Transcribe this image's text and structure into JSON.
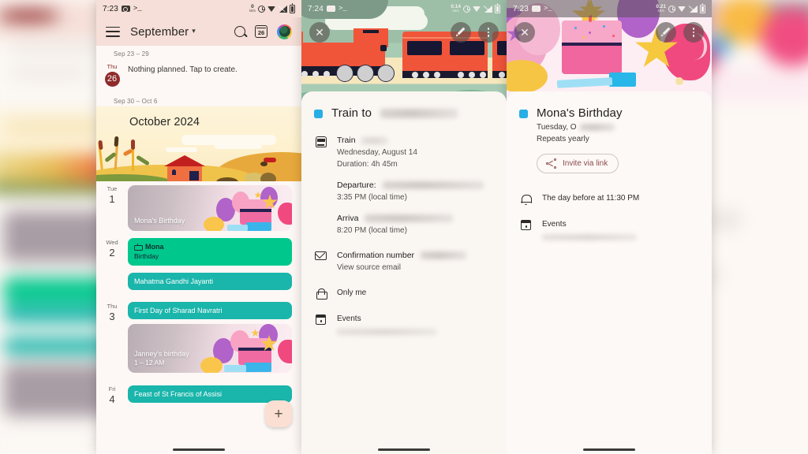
{
  "background": {
    "description": "blurred duplicate of calendar screen on left edge and birthday screen on right edge"
  },
  "panels": [
    {
      "id": "calendar",
      "statusbar": {
        "time": "7:23",
        "icons": [
          "camera-icon",
          "terminal-icon",
          "network-speed-icon",
          "alarm-icon",
          "wifi-icon",
          "signal-off-icon",
          "battery-icon"
        ],
        "network_speed_value": "0",
        "network_speed_unit": "kB/s"
      },
      "appbar": {
        "menu_icon": "hamburger-icon",
        "title": "September",
        "caret": "▾",
        "search_icon": "search-icon",
        "today_icon_label": "26",
        "avatar": "account-avatar"
      },
      "agenda": [
        {
          "type": "week-label",
          "text": "Sep 23 – 29"
        },
        {
          "type": "day",
          "weekday": "Thu",
          "day": "26",
          "today": true,
          "empty_text": "Nothing planned. Tap to create."
        },
        {
          "type": "week-label",
          "text": "Sep 30 – Oct 6"
        },
        {
          "type": "month-banner",
          "title": "October 2024"
        },
        {
          "type": "day",
          "weekday": "Tue",
          "day": "1",
          "today": false,
          "events": [
            {
              "style": "image-card",
              "title": "Mona's Birthday",
              "subtitle": ""
            }
          ]
        },
        {
          "type": "day",
          "weekday": "Wed",
          "day": "2",
          "today": false,
          "events": [
            {
              "style": "green",
              "title": "Mona",
              "subtitle": "Birthday",
              "icon": "cake-icon"
            },
            {
              "style": "teal",
              "title": "Mahatma Gandhi Jayanti"
            }
          ]
        },
        {
          "type": "day",
          "weekday": "Thu",
          "day": "3",
          "today": false,
          "events": [
            {
              "style": "teal",
              "title": "First Day of Sharad Navratri"
            },
            {
              "style": "image-card",
              "title": "Janney's birthday",
              "subtitle": "1 – 12 AM"
            }
          ]
        },
        {
          "type": "day",
          "weekday": "Fri",
          "day": "4",
          "today": false,
          "events": [
            {
              "style": "teal",
              "title": "Feast of St Francis of Assisi"
            }
          ]
        }
      ],
      "fab": {
        "icon": "plus-icon",
        "label": "+"
      }
    },
    {
      "id": "train-event",
      "statusbar": {
        "time": "7:24",
        "network_speed_value": "0.14",
        "network_speed_unit": "kB/s"
      },
      "hero": {
        "illustration": "train-illustration"
      },
      "actions": {
        "close_icon": "close-icon",
        "edit_icon": "pencil-icon",
        "more_icon": "more-vertical-icon"
      },
      "title": "Train to",
      "title_redacted": true,
      "rows": [
        {
          "icon": "train-icon",
          "lines": [
            {
              "text": "Train",
              "redacted_after": true,
              "strong": true
            },
            {
              "text": "Wednesday, August 14"
            },
            {
              "text": "Duration: 4h 45m"
            },
            {
              "text": "Departure:",
              "redacted_after": true,
              "strong": true,
              "spaced": true
            },
            {
              "text": "3:35 PM (local time)"
            },
            {
              "text": "Arriva",
              "redacted_after": true,
              "strong": true,
              "spaced": true
            },
            {
              "text": "8:20 PM (local time)"
            }
          ]
        },
        {
          "icon": "mail-icon",
          "lines": [
            {
              "text": "Confirmation number",
              "redacted_after": true,
              "strong": true
            },
            {
              "text": "View source email"
            }
          ]
        },
        {
          "icon": "lock-icon",
          "lines": [
            {
              "text": "Only me"
            }
          ]
        },
        {
          "icon": "calendar-icon",
          "lines": [
            {
              "text": "Events"
            },
            {
              "text": "",
              "redacted_line": true
            }
          ]
        }
      ]
    },
    {
      "id": "birthday-event",
      "statusbar": {
        "time": "7:23",
        "network_speed_value": "0.21",
        "network_speed_unit": "kB/s"
      },
      "hero": {
        "illustration": "birthday-cake-balloons-illustration"
      },
      "actions": {
        "close_icon": "close-icon",
        "edit_icon": "pencil-icon",
        "more_icon": "more-vertical-icon"
      },
      "title": "Mona's Birthday",
      "subtitle_prefix": "Tuesday, O",
      "subtitle_redacted": true,
      "repeat": "Repeats yearly",
      "invite_button": {
        "icon": "share-icon",
        "label": "Invite via link"
      },
      "rows": [
        {
          "icon": "bell-icon",
          "lines": [
            {
              "text": "The day before at 11:30 PM"
            }
          ]
        },
        {
          "icon": "calendar-icon",
          "lines": [
            {
              "text": "Events"
            },
            {
              "text": "",
              "redacted_line": true
            }
          ]
        }
      ]
    }
  ],
  "colors": {
    "calendar_header": "#f6dfd8",
    "chip_green": "#00c88d",
    "chip_teal": "#1ab5ab",
    "accent_blue": "#27aee4",
    "today_red": "#8f2b2b",
    "fab": "#fbdfd2",
    "invite_text": "#8a4a4e"
  }
}
